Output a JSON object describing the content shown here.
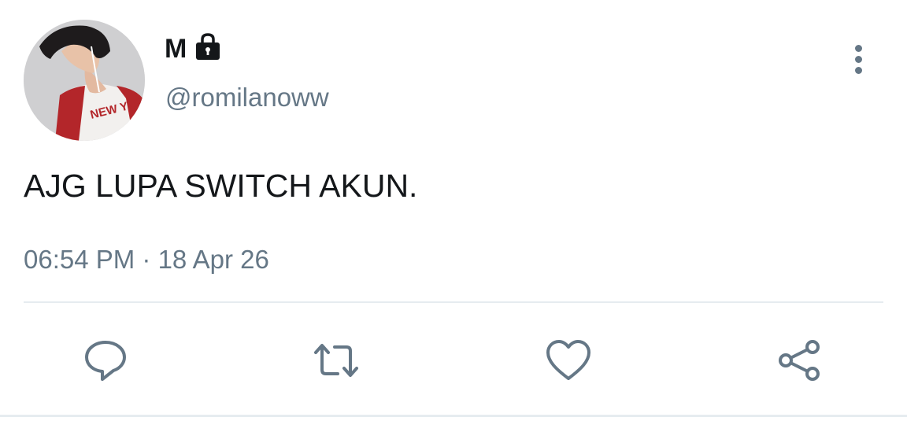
{
  "author": {
    "display_name": "M",
    "handle": "@romilanoww",
    "protected_icon": "lock-icon",
    "avatar_shirt_text": "NEW YOR"
  },
  "tweet": {
    "text": "AJG LUPA SWITCH AKUN.",
    "timestamp": "06:54 PM · 18 Apr 26"
  },
  "actions": [
    {
      "name": "reply",
      "icon": "reply-icon"
    },
    {
      "name": "retweet",
      "icon": "retweet-icon"
    },
    {
      "name": "like",
      "icon": "heart-icon"
    },
    {
      "name": "share",
      "icon": "share-icon"
    }
  ],
  "menu": {
    "icon": "more-vertical-icon"
  },
  "colors": {
    "text_primary": "#14171a",
    "text_secondary": "#657786",
    "icon_gray": "#657786",
    "divider": "#e6ecf0",
    "background": "#ffffff"
  }
}
